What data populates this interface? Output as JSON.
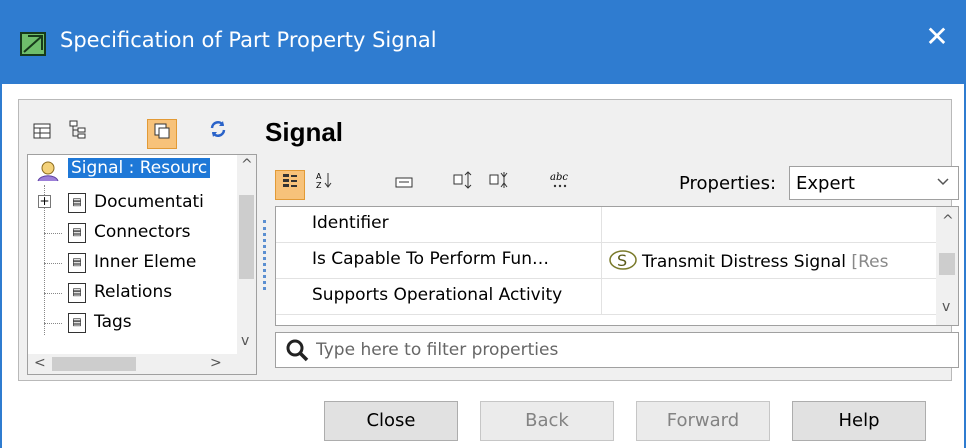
{
  "window": {
    "title": "Specification of Part Property Signal",
    "close_glyph": "✕"
  },
  "toolbar": {
    "icons": [
      "table-icon",
      "tree-icon",
      "panels-icon",
      "refresh-icon"
    ]
  },
  "heading": "Signal",
  "tree": {
    "root_label": "Signal : Resourc",
    "items": [
      {
        "label": "Documentati"
      },
      {
        "label": "Connectors"
      },
      {
        "label": "Inner Eleme"
      },
      {
        "label": "Relations"
      },
      {
        "label": "Tags"
      }
    ]
  },
  "properties": {
    "label": "Properties:",
    "mode": "Expert",
    "rows": [
      {
        "name": "Identifier",
        "value": "",
        "suffix": ""
      },
      {
        "name": "Is Capable To Perform Fun…",
        "value": "Transmit Distress Signal",
        "suffix": " [Res"
      },
      {
        "name": "Supports Operational Activity",
        "value": "",
        "suffix": ""
      }
    ],
    "filter_placeholder": "Type here to filter properties"
  },
  "buttons": {
    "close": "Close",
    "back": "Back",
    "forward": "Forward",
    "help": "Help"
  },
  "colors": {
    "titlebar": "#2f7cd0",
    "selection": "#1e78d7",
    "active_tool": "#f7c27a"
  }
}
